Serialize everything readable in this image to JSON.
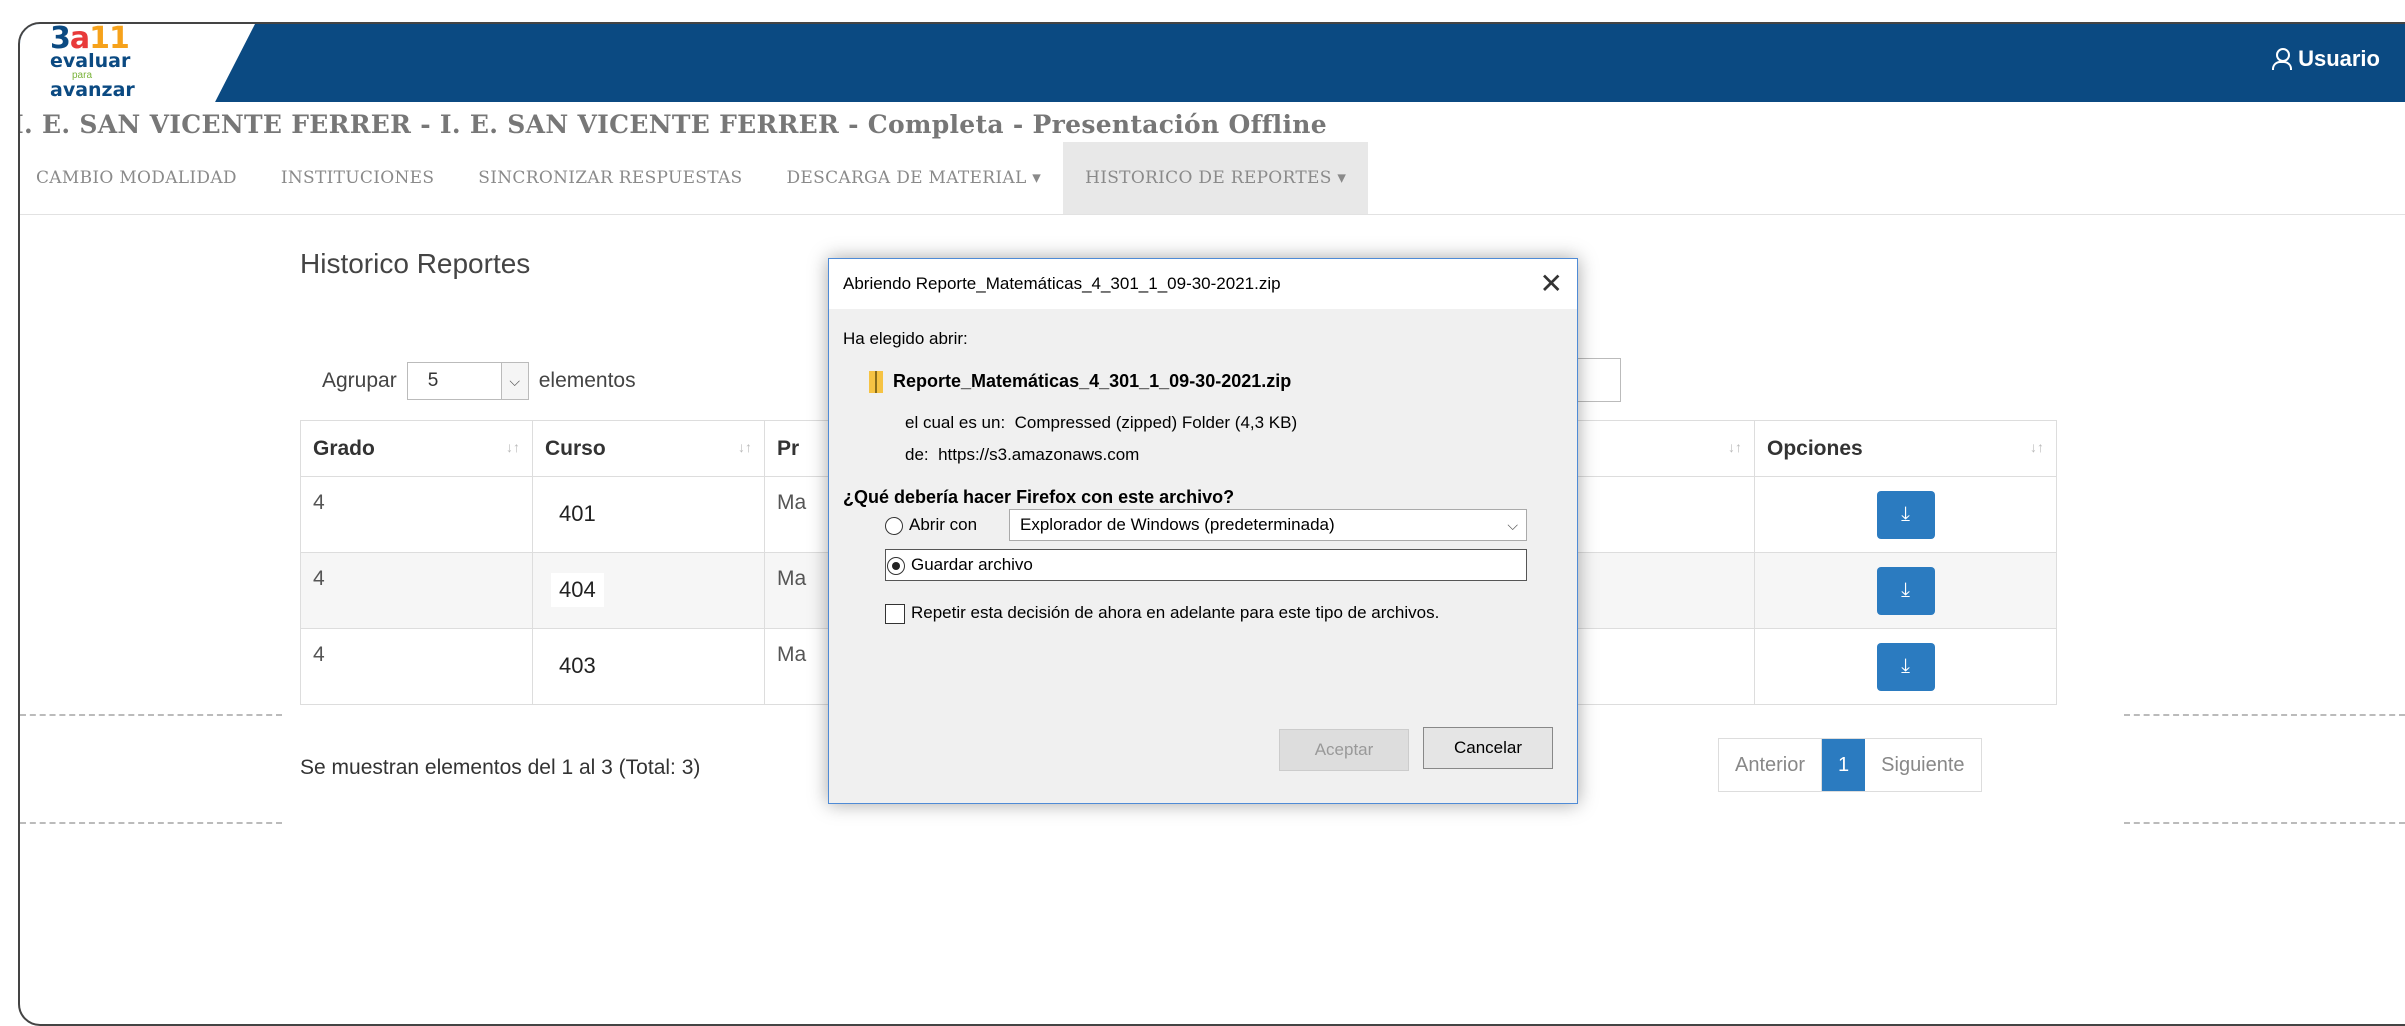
{
  "logo": {
    "line1_a": "3",
    "line1_b": "a",
    "line1_c": "11",
    "line2": "evaluar",
    "line3": "para",
    "line4": "avanzar"
  },
  "header": {
    "user_label": "Usuario"
  },
  "page": {
    "title": "I. E. SAN VICENTE FERRER - I. E. SAN VICENTE FERRER - Completa - Presentación Offline"
  },
  "tabs": [
    {
      "label": "CAMBIO MODALIDAD"
    },
    {
      "label": "INSTITUCIONES"
    },
    {
      "label": "SINCRONIZAR RESPUESTAS"
    },
    {
      "label": "DESCARGA DE MATERIAL ▾"
    },
    {
      "label": "HISTORICO DE REPORTES ▾"
    }
  ],
  "content": {
    "section_title": "Historico Reportes",
    "group_label": "Agrupar",
    "group_value": "5",
    "group_suffix": "elementos",
    "columns": {
      "grado": "Grado",
      "curso": "Curso",
      "prueba": "Pr",
      "opciones": "Opciones"
    },
    "rows": [
      {
        "grado": "4",
        "curso": "401",
        "prueba": "Ma"
      },
      {
        "grado": "4",
        "curso": "404",
        "prueba": "Ma"
      },
      {
        "grado": "4",
        "curso": "403",
        "prueba": "Ma"
      }
    ],
    "footer_info": "Se muestran elementos del 1 al 3 (Total: 3)",
    "pagination": {
      "prev": "Anterior",
      "current": "1",
      "next": "Siguiente"
    }
  },
  "dialog": {
    "title": "Abriendo Reporte_Matemáticas_4_301_1_09-30-2021.zip",
    "chose_open": "Ha elegido abrir:",
    "filename": "Reporte_Matemáticas_4_301_1_09-30-2021.zip",
    "type_label": "el cual es un:",
    "type_value": "Compressed (zipped) Folder (4,3 KB)",
    "from_label": "de:",
    "from_value": "https://s3.amazonaws.com",
    "question": "¿Qué debería hacer Firefox con este archivo?",
    "open_with_label": "Abrir con",
    "open_with_value": "Explorador de Windows (predeterminada)",
    "save_label": "Guardar archivo",
    "repeat_label": "Repetir esta decisión de ahora en adelante para este tipo de archivos.",
    "accept": "Aceptar",
    "cancel": "Cancelar"
  }
}
